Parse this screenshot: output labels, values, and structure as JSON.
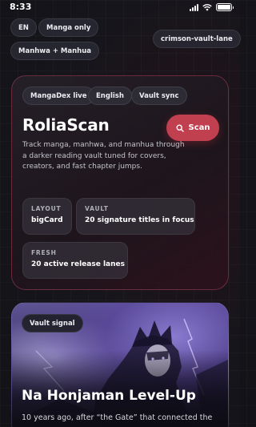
{
  "status_bar": {
    "time": "8:33",
    "battery_level": 1.0
  },
  "filters": {
    "language": "EN",
    "manga_only": "Manga only",
    "manhwa_manhua": "Manhwa + Manhua",
    "theme": "crimson-vault-lane"
  },
  "hero": {
    "tags": [
      "MangaDex live",
      "English",
      "Vault sync"
    ],
    "title": "RoliaScan",
    "scan_label": "Scan",
    "description": "Track manga, manhwa, and manhua through a darker reading vault tuned for covers, creators, and fast chapter jumps.",
    "stats": [
      {
        "label": "LAYOUT",
        "value": "bigCard"
      },
      {
        "label": "VAULT",
        "value": "20 signature titles in focus"
      },
      {
        "label": "FRESH",
        "value": "20 active release lanes"
      }
    ]
  },
  "featured": {
    "badge": "Vault signal",
    "title": "Na Honjaman Level-Up",
    "description": "10 years ago, after “the Gate” that connected the"
  },
  "colors": {
    "accent": "#c0404f",
    "background": "#15151b",
    "card_border": "#be465f"
  }
}
